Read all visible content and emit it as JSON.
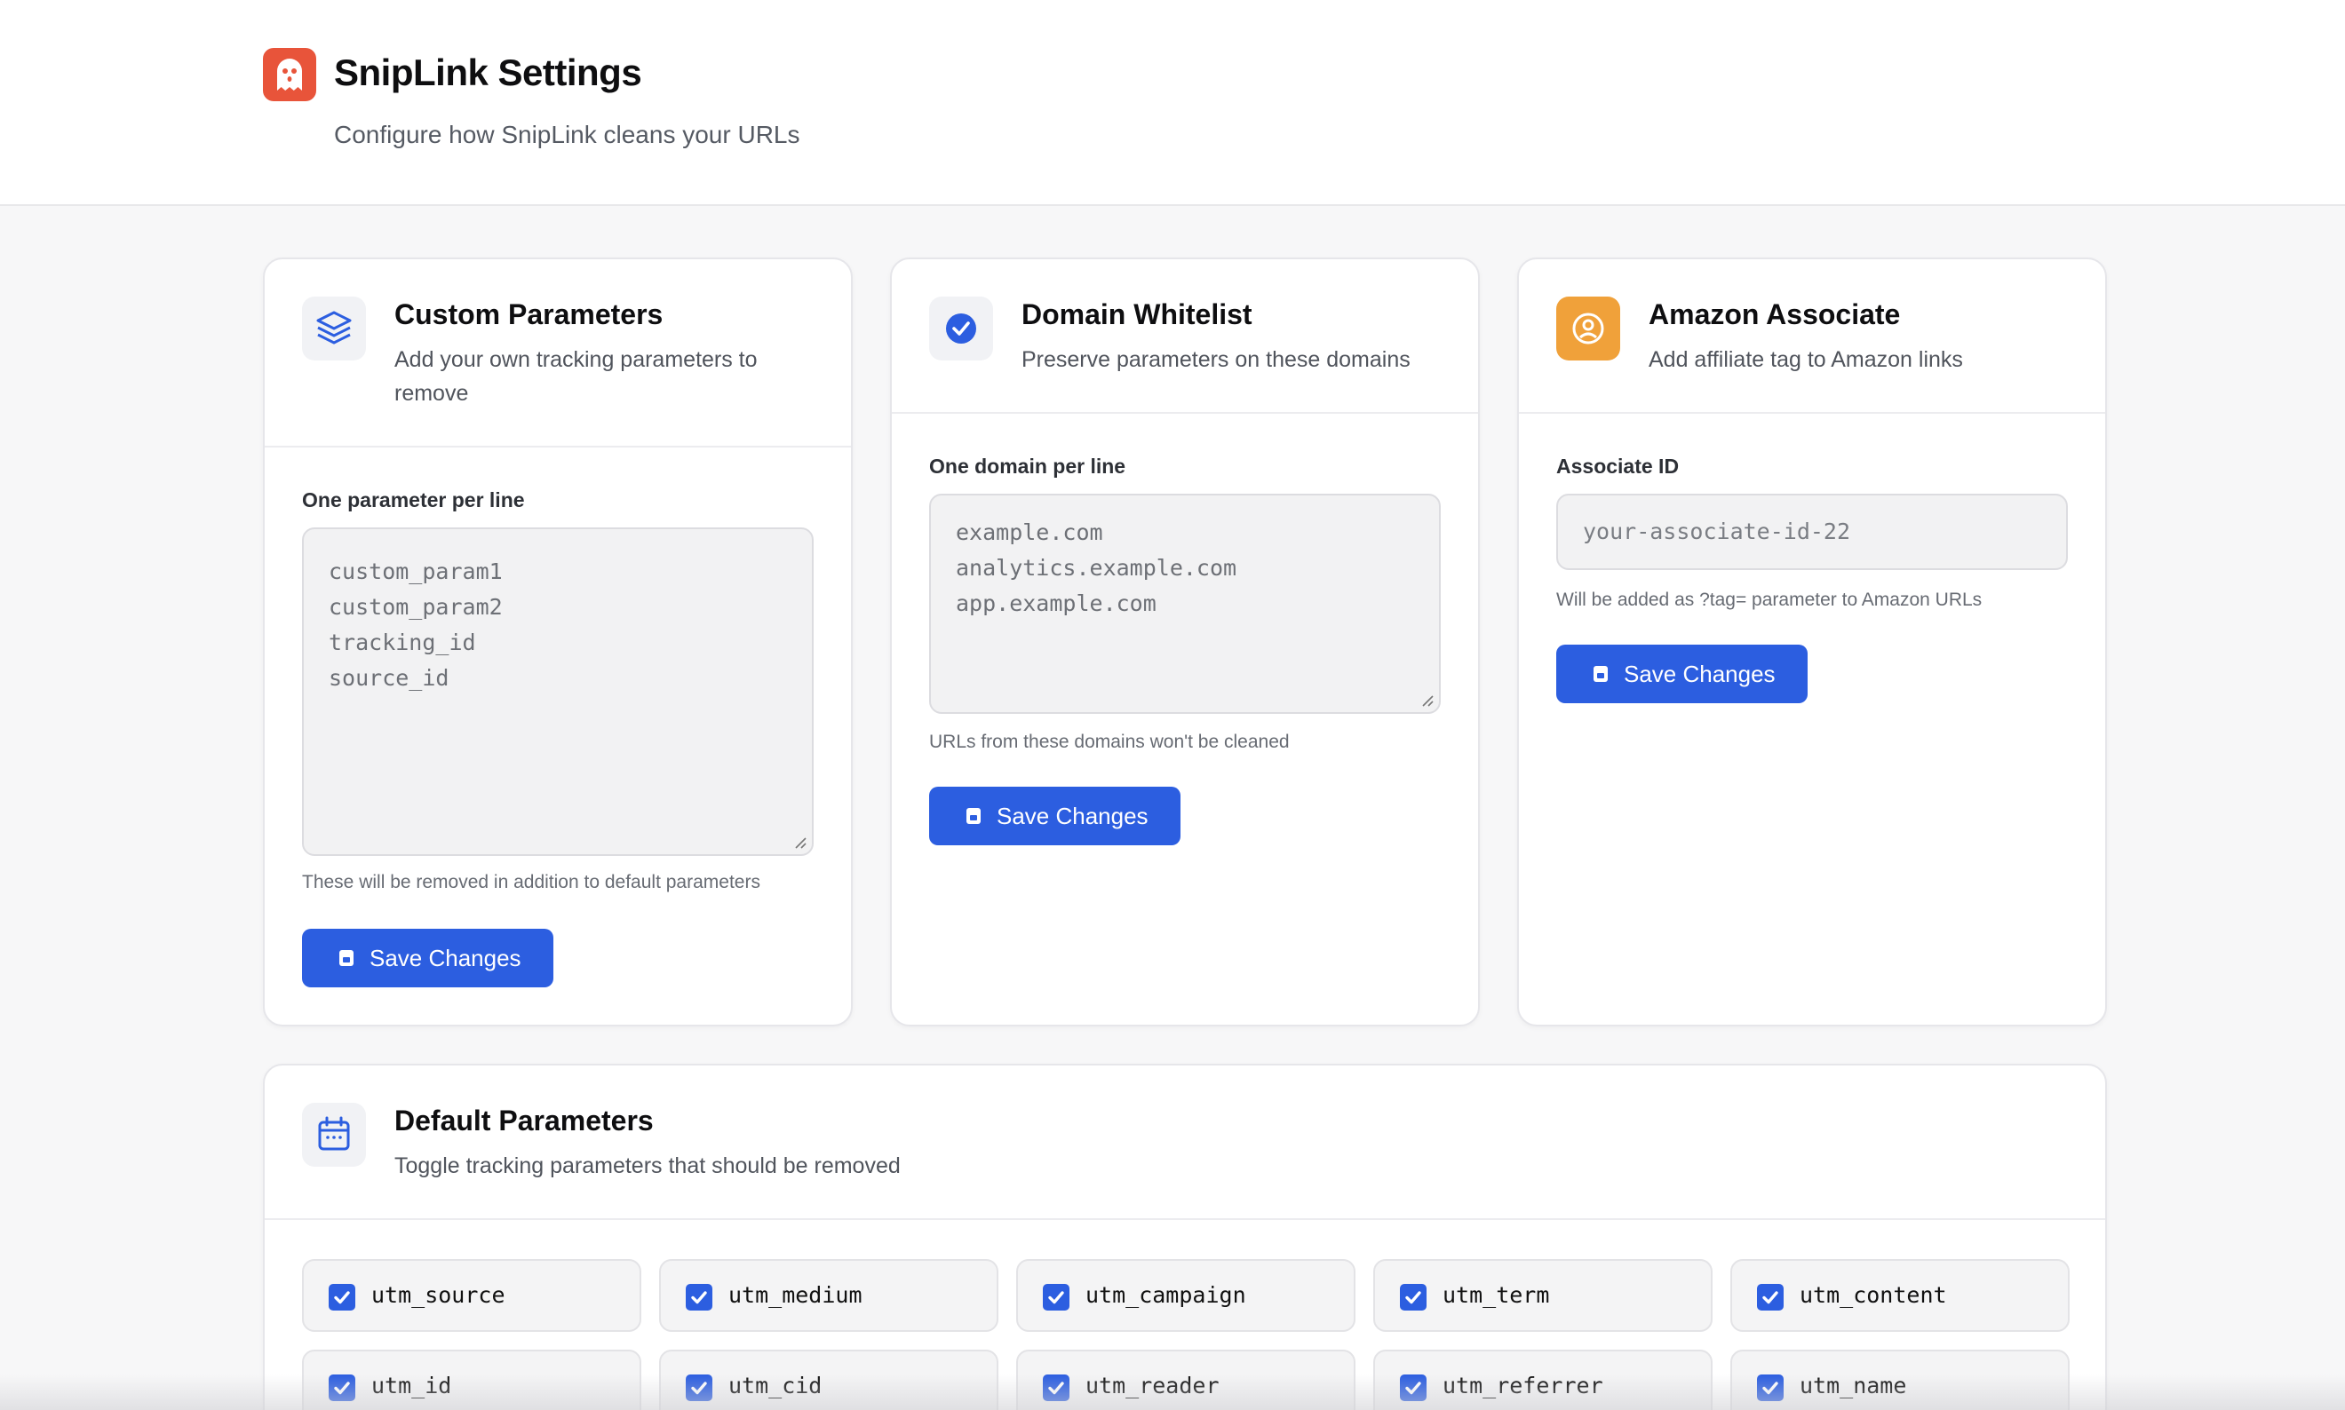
{
  "header": {
    "title": "SnipLink Settings",
    "subtitle": "Configure how SnipLink cleans your URLs"
  },
  "custom_params": {
    "title": "Custom Parameters",
    "description_line1": "Add your own tracking parameters to",
    "description_line2": "remove",
    "field_label": "One parameter per line",
    "placeholder_lines": [
      "custom_param1",
      "custom_param2",
      "tracking_id",
      "source_id"
    ],
    "hint": "These will be removed in addition to default parameters",
    "save_label": "Save Changes"
  },
  "domain_whitelist": {
    "title": "Domain Whitelist",
    "description": "Preserve parameters on these domains",
    "field_label": "One domain per line",
    "placeholder_lines": [
      "example.com",
      "analytics.example.com",
      "app.example.com"
    ],
    "hint": "URLs from these domains won't be cleaned",
    "save_label": "Save Changes"
  },
  "amazon": {
    "title": "Amazon Associate",
    "description": "Add affiliate tag to Amazon links",
    "field_label": "Associate ID",
    "placeholder": "your-associate-id-22",
    "hint": "Will be added as ?tag= parameter to Amazon URLs",
    "save_label": "Save Changes"
  },
  "default_params": {
    "title": "Default Parameters",
    "description": "Toggle tracking parameters that should be removed",
    "items": [
      {
        "name": "utm_source",
        "checked": true
      },
      {
        "name": "utm_medium",
        "checked": true
      },
      {
        "name": "utm_campaign",
        "checked": true
      },
      {
        "name": "utm_term",
        "checked": true
      },
      {
        "name": "utm_content",
        "checked": true
      },
      {
        "name": "utm_id",
        "checked": true
      },
      {
        "name": "utm_cid",
        "checked": true
      },
      {
        "name": "utm_reader",
        "checked": true
      },
      {
        "name": "utm_referrer",
        "checked": true
      },
      {
        "name": "utm_name",
        "checked": true
      }
    ]
  },
  "colors": {
    "accent": "#2c5ee0",
    "logo": "#e8543a",
    "amazon": "#f0a13a"
  },
  "icons": [
    "ghost-logo-icon",
    "layers-icon",
    "check-circle-icon",
    "user-circle-icon",
    "calendar-icon",
    "save-icon",
    "checkbox-check-icon"
  ]
}
